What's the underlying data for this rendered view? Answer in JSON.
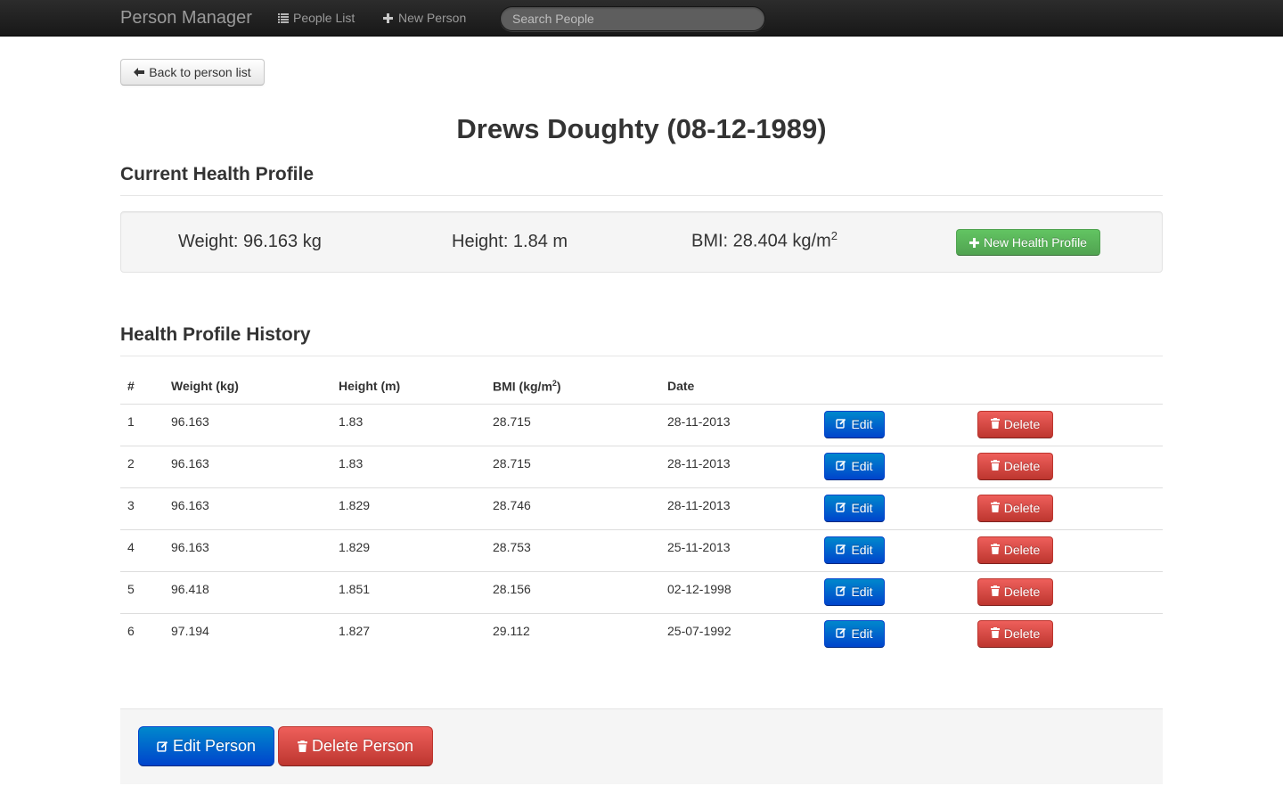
{
  "navbar": {
    "brand": "Person Manager",
    "links": [
      {
        "label": "People List",
        "icon": "list-icon"
      },
      {
        "label": "New Person",
        "icon": "plus-icon"
      }
    ],
    "search_placeholder": "Search People"
  },
  "back_button": {
    "label": "Back to person list",
    "icon": "arrow-left-icon"
  },
  "person": {
    "title": "Drews Doughty (08-12-1989)"
  },
  "current_profile": {
    "heading": "Current Health Profile",
    "weight": "Weight: 96.163 kg",
    "height": "Height: 1.84 m",
    "bmi_prefix": "BMI: 28.404 kg/m",
    "bmi_exp": "2",
    "new_button": "New Health Profile"
  },
  "history": {
    "heading": "Health Profile History",
    "columns": {
      "num": "#",
      "weight": "Weight (kg)",
      "height": "Height (m)",
      "bmi_prefix": "BMI (kg/m",
      "bmi_exp": "2",
      "bmi_suffix": ")",
      "date": "Date"
    },
    "edit_label": "Edit",
    "delete_label": "Delete",
    "rows": [
      {
        "num": "1",
        "weight": "96.163",
        "height": "1.83",
        "bmi": "28.715",
        "date": "28-11-2013"
      },
      {
        "num": "2",
        "weight": "96.163",
        "height": "1.83",
        "bmi": "28.715",
        "date": "28-11-2013"
      },
      {
        "num": "3",
        "weight": "96.163",
        "height": "1.829",
        "bmi": "28.746",
        "date": "28-11-2013"
      },
      {
        "num": "4",
        "weight": "96.163",
        "height": "1.829",
        "bmi": "28.753",
        "date": "25-11-2013"
      },
      {
        "num": "5",
        "weight": "96.418",
        "height": "1.851",
        "bmi": "28.156",
        "date": "02-12-1998"
      },
      {
        "num": "6",
        "weight": "97.194",
        "height": "1.827",
        "bmi": "29.112",
        "date": "25-07-1992"
      }
    ]
  },
  "actions": {
    "edit_person": "Edit Person",
    "delete_person": "Delete Person"
  },
  "colors": {
    "primary": "#0044cc",
    "danger": "#bd362f",
    "success": "#51a351",
    "navbar": "#1b1b1b"
  }
}
